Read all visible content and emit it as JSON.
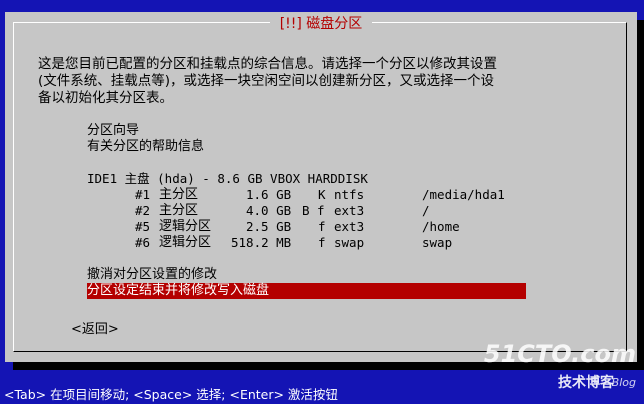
{
  "colors": {
    "background": "#1414b4",
    "dialog": "#c6c6c6",
    "title": "#b40000",
    "selection": "#b40000"
  },
  "dialog": {
    "title": "[!!] 磁盘分区",
    "intro": "这是您目前已配置的分区和挂载点的综合信息。请选择一个分区以修改其设置\n(文件系统、挂载点等)，或选择一块空闲空间以创建新分区，又或选择一个设\n备以初始化其分区表。"
  },
  "menu": {
    "wizard": "分区向导",
    "help": "有关分区的帮助信息",
    "disk": "IDE1 主盘 (hda) - 8.6 GB VBOX HARDDISK",
    "partitions": [
      {
        "num": "#1",
        "type": "主分区",
        "size": "1.6 GB",
        "flags": "K",
        "fs": "ntfs",
        "mount": "/media/hda1"
      },
      {
        "num": "#2",
        "type": "主分区",
        "size": "4.0 GB",
        "flags": "B f",
        "fs": "ext3",
        "mount": "/"
      },
      {
        "num": "#5",
        "type": "逻辑分区",
        "size": "2.5 GB",
        "flags": "f",
        "fs": "ext3",
        "mount": "/home"
      },
      {
        "num": "#6",
        "type": "逻辑分区",
        "size": "518.2 MB",
        "flags": "f",
        "fs": "swap",
        "mount": "swap"
      }
    ],
    "undo": "撤消对分区设置的修改",
    "finish": "分区设定结束并将修改写入磁盘"
  },
  "buttons": {
    "back": "<返回>"
  },
  "statusbar": "<Tab> 在项目间移动; <Space> 选择; <Enter> 激活按钮",
  "watermark": {
    "site": "51CTO.com",
    "tagline": "技术博客",
    "blog": "Blog"
  }
}
